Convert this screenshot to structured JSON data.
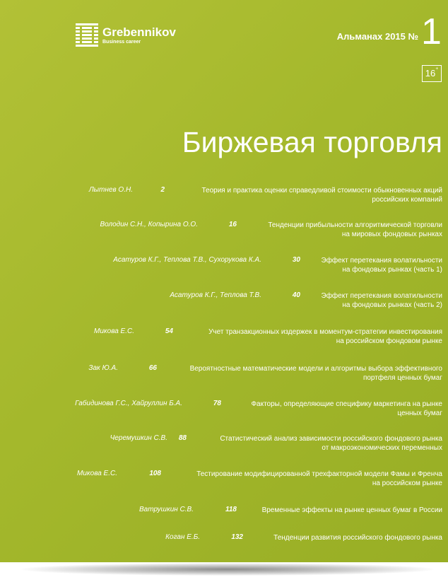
{
  "header": {
    "logo_name": "Grebennikov",
    "logo_tagline": "Business career",
    "almanac_label": "Альманах 2015 №",
    "issue_number": "1",
    "age_rating": "16",
    "age_rating_suffix": "+"
  },
  "title": "Биржевая торговля",
  "toc": [
    {
      "author": "Лытнев О.Н.",
      "page": "2",
      "desc_line1": "Теория и практика оценки справедливой стоимости обыкновенных акций",
      "desc_line2": "российских компаний"
    },
    {
      "author": "Володин С.Н., Копырина О.О.",
      "page": "16",
      "desc_line1": "Тенденции прибыльности алгоритмической торговли",
      "desc_line2": "на мировых фондовых рынках"
    },
    {
      "author": "Асатуров К.Г., Теплова Т.В., Сухорукова К.А.",
      "page": "30",
      "desc_line1": "Эффект перетекания волатильности",
      "desc_line2": "на фондовых рынках (часть 1)"
    },
    {
      "author": "Асатуров К.Г., Теплова Т.В.",
      "page": "40",
      "desc_line1": "Эффект перетекания волатильности",
      "desc_line2": "на фондовых рынках (часть 2)"
    },
    {
      "author": "Микова Е.С.",
      "page": "54",
      "desc_line1": "Учет транзакционных издержек в моментум-стратегии инвестирования",
      "desc_line2": "на российском фондовом рынке"
    },
    {
      "author": "Зак Ю.А.",
      "page": "66",
      "desc_line1": "Вероятностные математические модели и алгоритмы выбора эффективного",
      "desc_line2": "портфеля ценных бумаг"
    },
    {
      "author": "Габидинова Г.С., Хайруллин Б.А.",
      "page": "78",
      "desc_line1": "Факторы, определяющие специфику маркетинга на рынке",
      "desc_line2": "ценных бумаг"
    },
    {
      "author": "Черемушкин С.В.",
      "page": "88",
      "desc_line1": "Статистический анализ зависимости российского фондового рынка",
      "desc_line2": "от макроэкономических переменных"
    },
    {
      "author": "Микова Е.С.",
      "page": "108",
      "desc_line1": "Тестирование модифицированной трехфакторной модели Фамы и Френча",
      "desc_line2": "на российском рынке"
    },
    {
      "author": "Ватрушкин С.В.",
      "page": "118",
      "desc_line1": "Временные эффекты на рынке ценных бумаг в России",
      "desc_line2": ""
    },
    {
      "author": "Коган Е.Б.",
      "page": "132",
      "desc_line1": "Тенденции развития российского фондового рынка",
      "desc_line2": ""
    }
  ],
  "colors": {
    "cover_background": "#a4b82c",
    "text": "#ffffff"
  }
}
